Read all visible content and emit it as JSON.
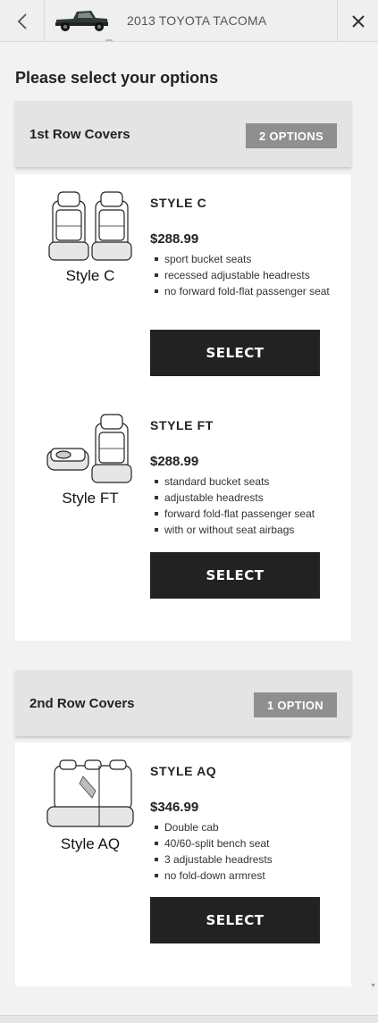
{
  "header": {
    "vehicle_title": "2013 TOYOTA TACOMA",
    "back_icon": "chevron-left-icon",
    "close_icon": "close-icon"
  },
  "page": {
    "title": "Please select your options"
  },
  "sections": [
    {
      "title": "1st Row Covers",
      "badge": "2 OPTIONS",
      "products": [
        {
          "image_caption": "Style C",
          "style_name": "STYLE C",
          "price": "$288.99",
          "features": [
            "sport bucket seats",
            "recessed adjustable headrests",
            "no forward fold-flat passenger seat"
          ],
          "button": "SELECT"
        },
        {
          "image_caption": "Style FT",
          "style_name": "STYLE FT",
          "price": "$288.99",
          "features": [
            "standard bucket seats",
            "adjustable headrests",
            "forward fold-flat passenger seat",
            "with or without seat airbags"
          ],
          "button": "SELECT"
        }
      ]
    },
    {
      "title": "2nd Row Covers",
      "badge": "1 OPTION",
      "products": [
        {
          "image_caption": "Style AQ",
          "style_name": "STYLE AQ",
          "price": "$346.99",
          "features": [
            "Double cab",
            "40/60-split bench seat",
            "3 adjustable headrests",
            "no fold-down armrest"
          ],
          "button": "SELECT"
        }
      ]
    }
  ],
  "colors": {
    "button_bg": "#222222",
    "badge_bg": "#8f8f8f",
    "header_bg": "#e4e4e4",
    "page_bg": "#f2f2f2"
  }
}
